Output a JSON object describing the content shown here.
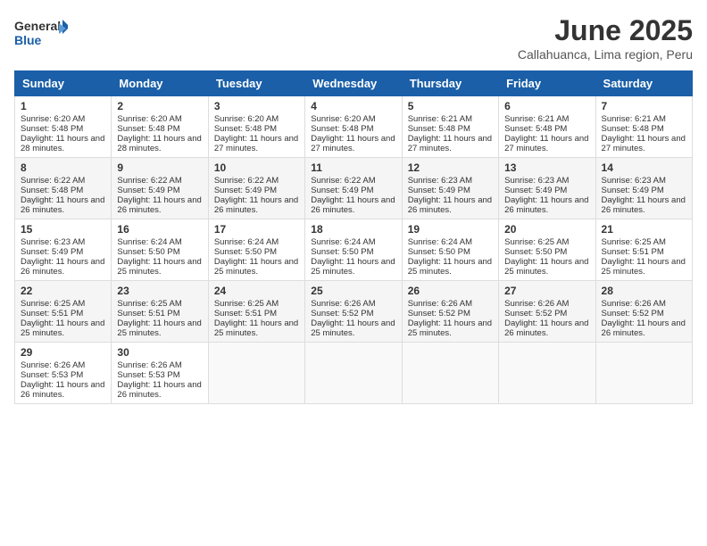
{
  "logo": {
    "general": "General",
    "blue": "Blue"
  },
  "title": "June 2025",
  "location": "Callahuanca, Lima region, Peru",
  "days_of_week": [
    "Sunday",
    "Monday",
    "Tuesday",
    "Wednesday",
    "Thursday",
    "Friday",
    "Saturday"
  ],
  "weeks": [
    [
      {
        "day": "1",
        "info": "Sunrise: 6:20 AM\nSunset: 5:48 PM\nDaylight: 11 hours and 28 minutes."
      },
      {
        "day": "2",
        "info": "Sunrise: 6:20 AM\nSunset: 5:48 PM\nDaylight: 11 hours and 28 minutes."
      },
      {
        "day": "3",
        "info": "Sunrise: 6:20 AM\nSunset: 5:48 PM\nDaylight: 11 hours and 27 minutes."
      },
      {
        "day": "4",
        "info": "Sunrise: 6:20 AM\nSunset: 5:48 PM\nDaylight: 11 hours and 27 minutes."
      },
      {
        "day": "5",
        "info": "Sunrise: 6:21 AM\nSunset: 5:48 PM\nDaylight: 11 hours and 27 minutes."
      },
      {
        "day": "6",
        "info": "Sunrise: 6:21 AM\nSunset: 5:48 PM\nDaylight: 11 hours and 27 minutes."
      },
      {
        "day": "7",
        "info": "Sunrise: 6:21 AM\nSunset: 5:48 PM\nDaylight: 11 hours and 27 minutes."
      }
    ],
    [
      {
        "day": "8",
        "info": "Sunrise: 6:22 AM\nSunset: 5:48 PM\nDaylight: 11 hours and 26 minutes."
      },
      {
        "day": "9",
        "info": "Sunrise: 6:22 AM\nSunset: 5:49 PM\nDaylight: 11 hours and 26 minutes."
      },
      {
        "day": "10",
        "info": "Sunrise: 6:22 AM\nSunset: 5:49 PM\nDaylight: 11 hours and 26 minutes."
      },
      {
        "day": "11",
        "info": "Sunrise: 6:22 AM\nSunset: 5:49 PM\nDaylight: 11 hours and 26 minutes."
      },
      {
        "day": "12",
        "info": "Sunrise: 6:23 AM\nSunset: 5:49 PM\nDaylight: 11 hours and 26 minutes."
      },
      {
        "day": "13",
        "info": "Sunrise: 6:23 AM\nSunset: 5:49 PM\nDaylight: 11 hours and 26 minutes."
      },
      {
        "day": "14",
        "info": "Sunrise: 6:23 AM\nSunset: 5:49 PM\nDaylight: 11 hours and 26 minutes."
      }
    ],
    [
      {
        "day": "15",
        "info": "Sunrise: 6:23 AM\nSunset: 5:49 PM\nDaylight: 11 hours and 26 minutes."
      },
      {
        "day": "16",
        "info": "Sunrise: 6:24 AM\nSunset: 5:50 PM\nDaylight: 11 hours and 25 minutes."
      },
      {
        "day": "17",
        "info": "Sunrise: 6:24 AM\nSunset: 5:50 PM\nDaylight: 11 hours and 25 minutes."
      },
      {
        "day": "18",
        "info": "Sunrise: 6:24 AM\nSunset: 5:50 PM\nDaylight: 11 hours and 25 minutes."
      },
      {
        "day": "19",
        "info": "Sunrise: 6:24 AM\nSunset: 5:50 PM\nDaylight: 11 hours and 25 minutes."
      },
      {
        "day": "20",
        "info": "Sunrise: 6:25 AM\nSunset: 5:50 PM\nDaylight: 11 hours and 25 minutes."
      },
      {
        "day": "21",
        "info": "Sunrise: 6:25 AM\nSunset: 5:51 PM\nDaylight: 11 hours and 25 minutes."
      }
    ],
    [
      {
        "day": "22",
        "info": "Sunrise: 6:25 AM\nSunset: 5:51 PM\nDaylight: 11 hours and 25 minutes."
      },
      {
        "day": "23",
        "info": "Sunrise: 6:25 AM\nSunset: 5:51 PM\nDaylight: 11 hours and 25 minutes."
      },
      {
        "day": "24",
        "info": "Sunrise: 6:25 AM\nSunset: 5:51 PM\nDaylight: 11 hours and 25 minutes."
      },
      {
        "day": "25",
        "info": "Sunrise: 6:26 AM\nSunset: 5:52 PM\nDaylight: 11 hours and 25 minutes."
      },
      {
        "day": "26",
        "info": "Sunrise: 6:26 AM\nSunset: 5:52 PM\nDaylight: 11 hours and 25 minutes."
      },
      {
        "day": "27",
        "info": "Sunrise: 6:26 AM\nSunset: 5:52 PM\nDaylight: 11 hours and 26 minutes."
      },
      {
        "day": "28",
        "info": "Sunrise: 6:26 AM\nSunset: 5:52 PM\nDaylight: 11 hours and 26 minutes."
      }
    ],
    [
      {
        "day": "29",
        "info": "Sunrise: 6:26 AM\nSunset: 5:53 PM\nDaylight: 11 hours and 26 minutes."
      },
      {
        "day": "30",
        "info": "Sunrise: 6:26 AM\nSunset: 5:53 PM\nDaylight: 11 hours and 26 minutes."
      },
      {
        "day": "",
        "info": ""
      },
      {
        "day": "",
        "info": ""
      },
      {
        "day": "",
        "info": ""
      },
      {
        "day": "",
        "info": ""
      },
      {
        "day": "",
        "info": ""
      }
    ]
  ]
}
